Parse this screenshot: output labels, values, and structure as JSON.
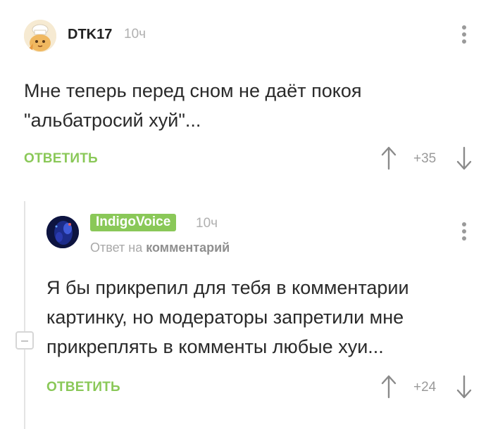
{
  "comments": [
    {
      "username": "DTK17",
      "time": "10ч",
      "text_lines": [
        "Мне теперь перед сном не даёт покоя",
        "\"альбатросий хуй\"..."
      ],
      "reply_label": "ОТВЕТИТЬ",
      "score": "+35",
      "avatar_icon": "chef-cat-avatar"
    },
    {
      "username": "IndigoVoice",
      "time": "10ч",
      "reply_to_prefix": "Ответ на",
      "reply_to_target": "комментарий",
      "text_lines": [
        "Я бы прикрепил для тебя в комментарии",
        "картинку, но модераторы запретили мне",
        "прикреплять в комменты любые хуи..."
      ],
      "reply_label": "ОТВЕТИТЬ",
      "score": "+24",
      "avatar_icon": "dark-blue-avatar"
    }
  ],
  "colors": {
    "accent": "#8ac858",
    "muted": "#9a9a9a",
    "thread_line": "#e4e4e4"
  }
}
